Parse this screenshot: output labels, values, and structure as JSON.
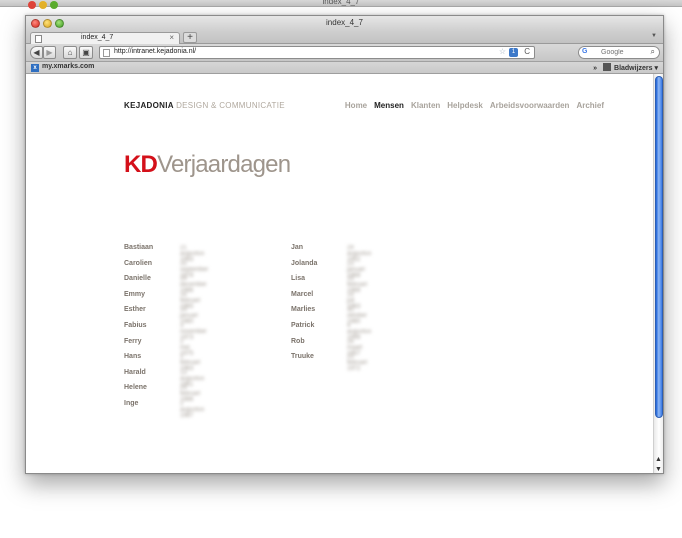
{
  "background_window": {
    "title": "index_4_7"
  },
  "window": {
    "title": "index_4_7"
  },
  "tab": {
    "label": "index_4_7",
    "close": "×",
    "new_tab": "+"
  },
  "navbar": {
    "back": "◀",
    "forward": "▶",
    "home": "⌂",
    "history": "▣",
    "url": "http://intranet.kejadonia.nl/",
    "star": "☆",
    "rss": "1",
    "reload": "C",
    "search_engine": "▾",
    "search_logo": "G",
    "search_placeholder": "Google",
    "search_icon": "⌕"
  },
  "bookmarks": {
    "left_favicon": "x",
    "left_label": "my.xmarks.com",
    "right_chevron": "»",
    "right_label": "Bladwijzers ▾"
  },
  "site": {
    "brand": "KEJADONIA",
    "brand_sub": "DESIGN & COMMUNICATIE",
    "menu": [
      "Home",
      "Mensen",
      "Klanten",
      "Helpdesk",
      "Arbeidsvoorwaarden",
      "Archief"
    ],
    "active_menu": "Mensen",
    "heading_prefix": "KD",
    "heading_rest": "Verjaardagen"
  },
  "birthdays_col1": [
    {
      "name": "Bastiaan",
      "date": "21 augustus 1983"
    },
    {
      "name": "Carolien",
      "date": "25 september 1978"
    },
    {
      "name": "Danielle",
      "date": "29 december 1986"
    },
    {
      "name": "Emmy",
      "date": "16 februari 1965"
    },
    {
      "name": "Esther",
      "date": "14 januari 1980"
    },
    {
      "name": "Fabius",
      "date": "3 november 1973"
    },
    {
      "name": "Ferry",
      "date": "2 mei 1975"
    },
    {
      "name": "Hans",
      "date": "1 februari 1963"
    },
    {
      "name": "Harald",
      "date": "13 augustus 1961"
    },
    {
      "name": "Helene",
      "date": "24 februari 1986"
    },
    {
      "name": "Inge",
      "date": "2 augustus 1987"
    }
  ],
  "birthdays_col2": [
    {
      "name": "Jan",
      "date": "29 augustus 1952"
    },
    {
      "name": "Jolanda",
      "date": "23 januari 1968"
    },
    {
      "name": "Lisa",
      "date": "19 februari 1989"
    },
    {
      "name": "Marcel",
      "date": "19 juli 1963"
    },
    {
      "name": "Marlies",
      "date": "30 oktober 1980"
    },
    {
      "name": "Patrick",
      "date": "4 augustus 1999"
    },
    {
      "name": "Rob",
      "date": "26 maart 1957"
    },
    {
      "name": "Truuke",
      "date": "23 februari 1972"
    }
  ],
  "scrollbar": {
    "up": "▲",
    "down": "▼"
  },
  "colors": {
    "brand_red": "#d4101a",
    "heading_gray": "#9e958c",
    "scroll_blue": "#1a5fd6"
  }
}
